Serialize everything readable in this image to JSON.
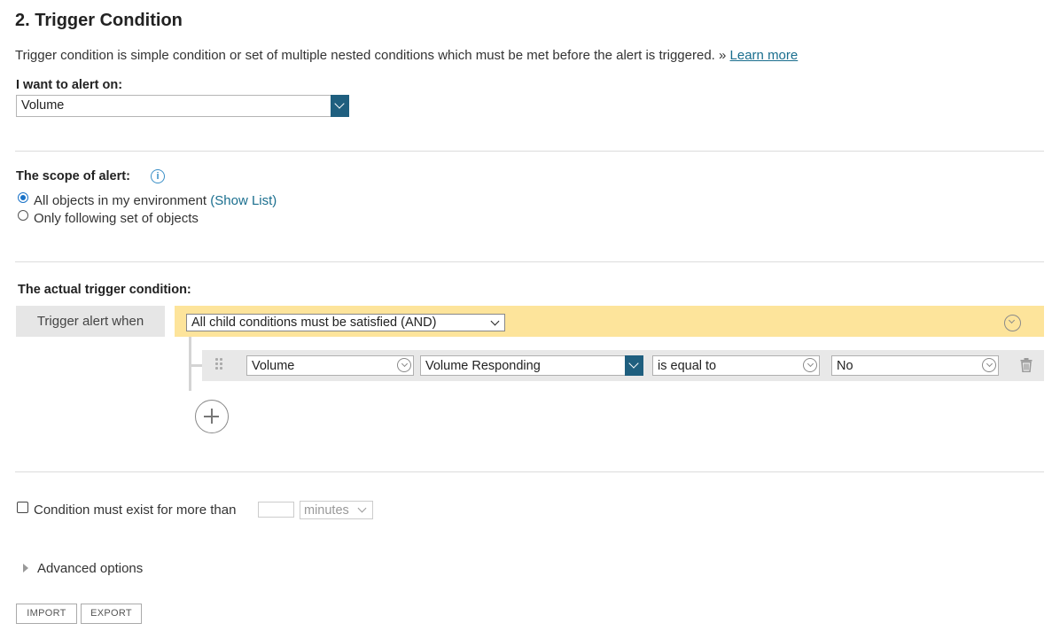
{
  "section": {
    "title": "2. Trigger Condition",
    "description": "Trigger condition is simple condition or set of multiple nested conditions which must be met before the alert is triggered. »",
    "learn_more": "Learn more"
  },
  "alert_on": {
    "label": "I want to alert on:",
    "value": "Volume"
  },
  "scope": {
    "label": "The scope of alert:",
    "info_icon": "info-icon",
    "options": [
      {
        "label": "All objects in my environment",
        "link": "(Show List)",
        "selected": true
      },
      {
        "label": "Only following set of objects",
        "selected": false
      }
    ]
  },
  "trigger": {
    "label": "The actual trigger condition:",
    "when_label": "Trigger alert when",
    "group_value": "All child conditions must be satisfied (AND)",
    "condition": {
      "object": "Volume",
      "field": "Volume Responding",
      "operator": "is equal to",
      "value": "No"
    },
    "highlight_color": "#fde49b"
  },
  "duration": {
    "label": "Condition must exist for more than",
    "value": "",
    "unit": "minutes",
    "checked": false
  },
  "advanced": {
    "label": "Advanced options"
  },
  "buttons": {
    "import": "IMPORT",
    "export": "EXPORT"
  }
}
